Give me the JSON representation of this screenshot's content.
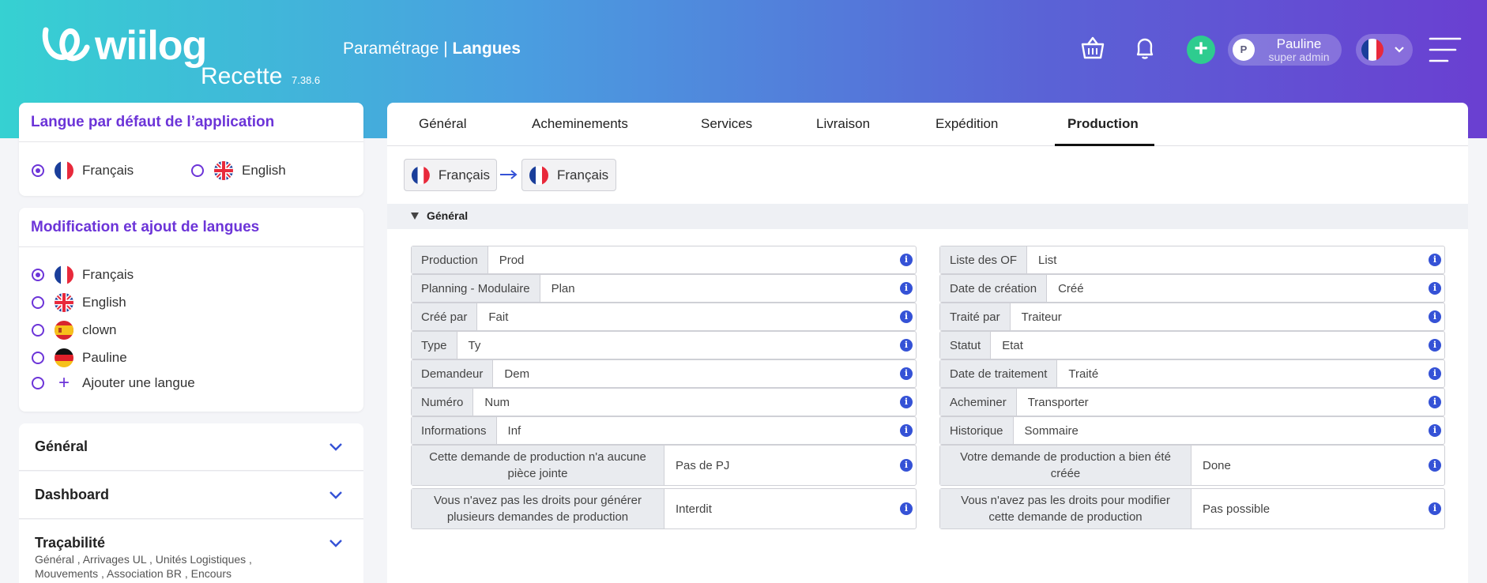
{
  "app": {
    "logo_text": "wiilog",
    "environment": "Recette",
    "version": "7.38.6",
    "breadcrumb_parent": "Paramétrage |",
    "breadcrumb_current": "Langues"
  },
  "header": {
    "icons": [
      "basket-icon",
      "bell-icon",
      "plus-icon",
      "menu-icon"
    ],
    "user": {
      "initial": "P",
      "name": "Pauline",
      "role": "super admin"
    },
    "language_flag": "fr-flag"
  },
  "colors": {
    "accent": "#6c34d8",
    "gradient_start": "#36d1d2",
    "gradient_end": "#6a3fd1",
    "plus_green": "#2ecc8f",
    "info_blue": "#3552d6"
  },
  "default_language": {
    "title": "Langue par défaut de l’application",
    "options": [
      {
        "label": "Français",
        "flag": "fr",
        "checked": true
      },
      {
        "label": "English",
        "flag": "uk",
        "checked": false
      }
    ]
  },
  "edit_languages": {
    "title": "Modification et ajout de langues",
    "options": [
      {
        "label": "Français",
        "flag": "fr",
        "checked": true
      },
      {
        "label": "English",
        "flag": "uk",
        "checked": false
      },
      {
        "label": "clown",
        "flag": "es",
        "checked": false
      },
      {
        "label": "Pauline",
        "flag": "de",
        "checked": false
      },
      {
        "label": "Ajouter une langue",
        "flag": "plus",
        "checked": false
      }
    ]
  },
  "accordions": [
    {
      "title": "Général",
      "subtitle": ""
    },
    {
      "title": "Dashboard",
      "subtitle": ""
    },
    {
      "title": "Traçabilité",
      "subtitle": "Général , Arrivages UL , Unités Logistiques , Mouvements , Association BR , Encours"
    }
  ],
  "tabs": [
    "Général",
    "Acheminements",
    "Services",
    "Livraison",
    "Expédition",
    "Production"
  ],
  "active_tab": "Production",
  "translation": {
    "source": "Français",
    "target": "Français"
  },
  "section": {
    "title": "Général"
  },
  "fields_left": [
    {
      "label": "Production",
      "value": "Prod"
    },
    {
      "label": "Planning - Modulaire",
      "value": "Plan"
    },
    {
      "label": "Créé par",
      "value": "Fait"
    },
    {
      "label": "Type",
      "value": "Ty"
    },
    {
      "label": "Demandeur",
      "value": "Dem"
    },
    {
      "label": "Numéro",
      "value": "Num"
    },
    {
      "label": "Informations",
      "value": "Inf"
    },
    {
      "label": "Cette demande de production n'a aucune pièce jointe",
      "value": "Pas de PJ"
    },
    {
      "label": "Vous n'avez pas les droits pour générer plusieurs demandes de production",
      "value": "Interdit"
    }
  ],
  "fields_right": [
    {
      "label": "Liste des OF",
      "value": "List"
    },
    {
      "label": "Date de création",
      "value": "Créé"
    },
    {
      "label": "Traité par",
      "value": "Traiteur"
    },
    {
      "label": "Statut",
      "value": "Etat"
    },
    {
      "label": "Date de traitement",
      "value": "Traité"
    },
    {
      "label": "Acheminer",
      "value": "Transporter"
    },
    {
      "label": "Historique",
      "value": "Sommaire"
    },
    {
      "label": "Votre demande de production a bien été créée",
      "value": "Done"
    },
    {
      "label": "Vous n'avez pas les droits pour modifier cette demande de production",
      "value": "Pas possible"
    }
  ],
  "info_glyph": "i"
}
